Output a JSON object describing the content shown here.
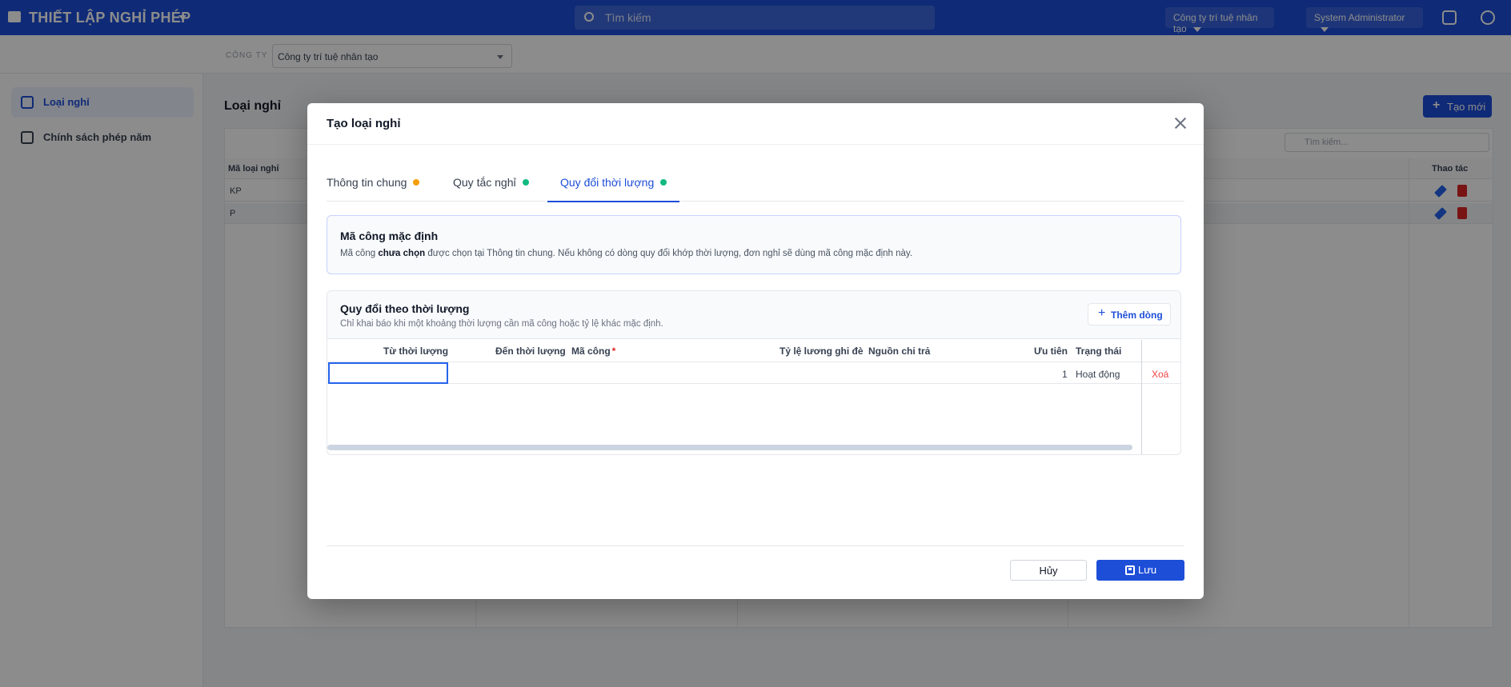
{
  "app": {
    "title": "THIẾT LẬP NGHỈ PHÉP",
    "search_placeholder": "Tìm kiếm",
    "company_pill": "Công ty trí tuệ nhân tạo",
    "user_pill": "System Administrator"
  },
  "subbar": {
    "company_label": "CÔNG TY",
    "company_value": "Công ty trí tuệ nhân tạo"
  },
  "sidebar": {
    "items": [
      {
        "label": "Loại nghỉ",
        "icon": "layers-icon",
        "active": true
      },
      {
        "label": "Chính sách phép năm",
        "icon": "calendar-icon",
        "active": false
      }
    ]
  },
  "main": {
    "title": "Loại nghỉ",
    "new_button": "Tạo mới",
    "grid_search_placeholder": "Tìm kiếm...",
    "columns": [
      "Mã loại nghỉ",
      "Thao tác"
    ],
    "rows": [
      {
        "code": "KP"
      },
      {
        "code": "P"
      }
    ]
  },
  "modal": {
    "title": "Tạo loại nghỉ",
    "tabs": [
      {
        "label": "Thông tin chung",
        "dot_color": "#f59e0b",
        "active": false
      },
      {
        "label": "Quy tắc nghỉ",
        "dot_color": "#10b981",
        "active": false
      },
      {
        "label": "Quy đổi thời lượng",
        "dot_color": "#10b981",
        "active": true
      }
    ],
    "default_code": {
      "title": "Mã công mặc định",
      "desc_prefix": "Mã công ",
      "desc_bold": "chưa chọn",
      "desc_suffix": " được chọn tại Thông tin chung. Nếu không có dòng quy đổi khớp thời lượng, đơn nghỉ sẽ dùng mã công mặc định này."
    },
    "conversion": {
      "title": "Quy đổi theo thời lượng",
      "desc": "Chỉ khai báo khi một khoảng thời lượng cần mã công hoặc tỷ lệ khác mặc định.",
      "add_row_label": "Thêm dòng",
      "headers": {
        "from": "Từ thời lượng",
        "to": "Đến thời lượng",
        "code": "Mã công",
        "required_mark": "*",
        "rate": "Tỷ lệ lương ghi đè",
        "source": "Nguồn chi trả",
        "priority": "Ưu tiên",
        "status": "Trạng thái"
      },
      "rows": [
        {
          "from": "",
          "to": "",
          "code": "",
          "rate": "",
          "source": "",
          "priority": "1",
          "status": "Hoạt động",
          "delete_label": "Xoá"
        }
      ]
    },
    "cancel_label": "Hủy",
    "save_label": "Lưu"
  }
}
